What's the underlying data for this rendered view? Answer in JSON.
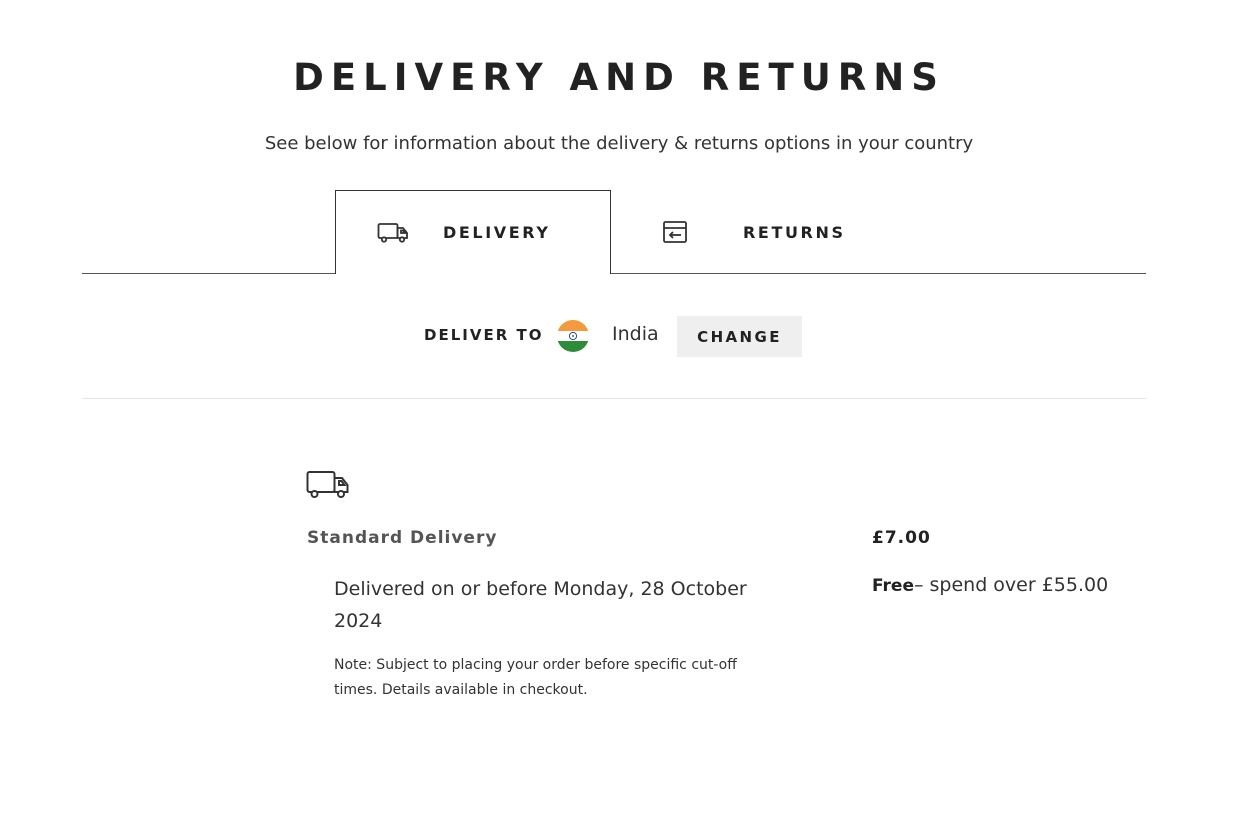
{
  "header": {
    "title": "DELIVERY AND RETURNS",
    "subtitle": "See below for information about the delivery & returns options in your country"
  },
  "tabs": [
    {
      "label": "DELIVERY",
      "icon": "truck-icon",
      "active": true
    },
    {
      "label": "RETURNS",
      "icon": "return-box-icon",
      "active": false
    }
  ],
  "deliver_to": {
    "label": "DELIVER TO",
    "country": "India",
    "flag_icon": "india-flag-icon",
    "change_label": "CHANGE"
  },
  "delivery_options": [
    {
      "icon": "truck-icon",
      "name": "Standard Delivery",
      "estimate": "Delivered on or before Monday, 28 October 2024",
      "note": "Note: Subject to placing your order before specific cut-off times. Details available in checkout.",
      "price": "£7.00",
      "free_label": "Free",
      "free_condition": "– spend over £55.00"
    }
  ],
  "colors": {
    "text": "#222222",
    "muted": "#555555",
    "button_bg": "#efefef",
    "flag_saffron": "#f39a3c",
    "flag_green": "#2e8b3a",
    "flag_chakra": "#1a3a8a"
  }
}
